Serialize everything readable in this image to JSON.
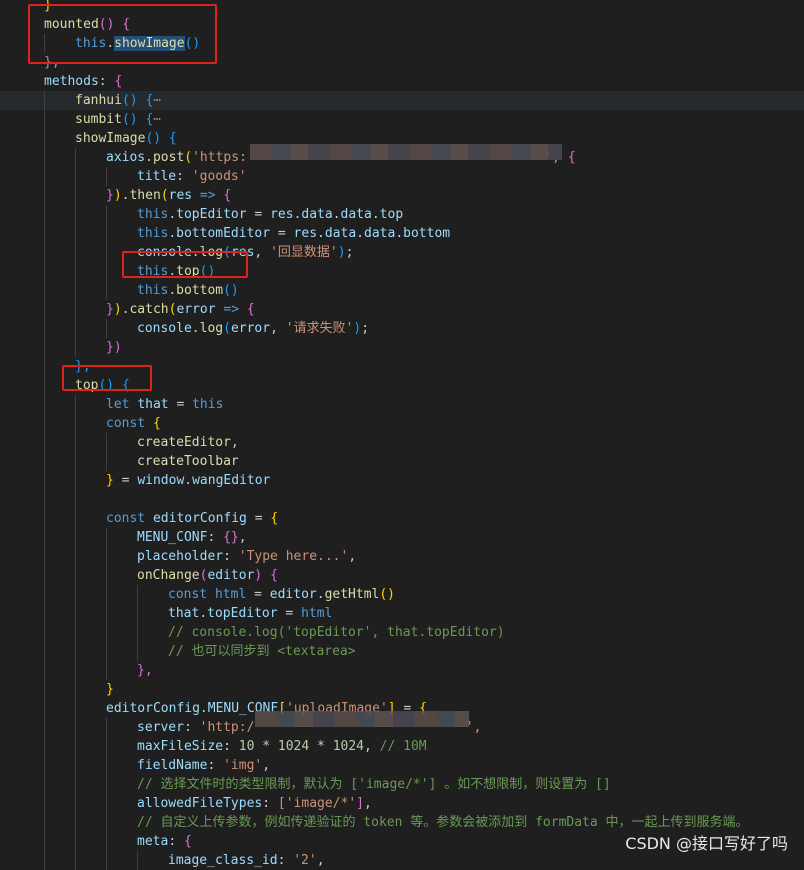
{
  "lines": [
    {
      "indent": 1,
      "tokens": [
        {
          "t": "}",
          "c": "b1"
        }
      ]
    },
    {
      "indent": 1,
      "tokens": [
        {
          "t": "mounted",
          "c": "fn"
        },
        {
          "t": "() {",
          "c": "b2"
        }
      ]
    },
    {
      "indent": 2,
      "tokens": [
        {
          "t": "this",
          "c": "kw"
        },
        {
          "t": ".",
          "c": "pn"
        },
        {
          "t": "showImage",
          "c": "fn sel"
        },
        {
          "t": "()",
          "c": "b3"
        }
      ]
    },
    {
      "indent": 1,
      "tokens": [
        {
          "t": "},",
          "c": "b2"
        }
      ]
    },
    {
      "indent": 1,
      "tokens": [
        {
          "t": "methods",
          "c": "prop"
        },
        {
          "t": ": ",
          "c": "pn"
        },
        {
          "t": "{",
          "c": "b2"
        }
      ]
    },
    {
      "indent": 2,
      "hl": true,
      "tokens": [
        {
          "t": "fanhui",
          "c": "fn"
        },
        {
          "t": "() {",
          "c": "b3"
        },
        {
          "t": "⋯",
          "c": "fold"
        }
      ]
    },
    {
      "indent": 2,
      "tokens": [
        {
          "t": "sumbit",
          "c": "fn"
        },
        {
          "t": "() {",
          "c": "b3"
        },
        {
          "t": "⋯",
          "c": "fold"
        }
      ]
    },
    {
      "indent": 2,
      "tokens": [
        {
          "t": "showImage",
          "c": "fn"
        },
        {
          "t": "() {",
          "c": "b3"
        }
      ]
    },
    {
      "indent": 3,
      "tokens": [
        {
          "t": "axios",
          "c": "prop"
        },
        {
          "t": ".",
          "c": "pn"
        },
        {
          "t": "post",
          "c": "fn"
        },
        {
          "t": "(",
          "c": "b1"
        },
        {
          "t": "'https:",
          "c": "str"
        },
        {
          "t": "                                      ",
          "c": "pn"
        },
        {
          "t": "', ",
          "c": "str"
        },
        {
          "t": "{",
          "c": "b2"
        }
      ]
    },
    {
      "indent": 4,
      "tokens": [
        {
          "t": "title",
          "c": "prop"
        },
        {
          "t": ": ",
          "c": "pn"
        },
        {
          "t": "'goods'",
          "c": "str"
        }
      ]
    },
    {
      "indent": 3,
      "tokens": [
        {
          "t": "}",
          "c": "b2"
        },
        {
          "t": ")",
          "c": "b1"
        },
        {
          "t": ".",
          "c": "pn"
        },
        {
          "t": "then",
          "c": "fn"
        },
        {
          "t": "(",
          "c": "b1"
        },
        {
          "t": "res",
          "c": "prop"
        },
        {
          "t": " => ",
          "c": "kw"
        },
        {
          "t": "{",
          "c": "b2"
        }
      ]
    },
    {
      "indent": 4,
      "tokens": [
        {
          "t": "this",
          "c": "kw"
        },
        {
          "t": ".",
          "c": "pn"
        },
        {
          "t": "topEditor",
          "c": "prop"
        },
        {
          "t": " = ",
          "c": "pn"
        },
        {
          "t": "res",
          "c": "prop"
        },
        {
          "t": ".",
          "c": "pn"
        },
        {
          "t": "data",
          "c": "prop"
        },
        {
          "t": ".",
          "c": "pn"
        },
        {
          "t": "data",
          "c": "prop"
        },
        {
          "t": ".",
          "c": "pn"
        },
        {
          "t": "top",
          "c": "prop"
        }
      ]
    },
    {
      "indent": 4,
      "tokens": [
        {
          "t": "this",
          "c": "kw"
        },
        {
          "t": ".",
          "c": "pn"
        },
        {
          "t": "bottomEditor",
          "c": "prop"
        },
        {
          "t": " = ",
          "c": "pn"
        },
        {
          "t": "res",
          "c": "prop"
        },
        {
          "t": ".",
          "c": "pn"
        },
        {
          "t": "data",
          "c": "prop"
        },
        {
          "t": ".",
          "c": "pn"
        },
        {
          "t": "data",
          "c": "prop"
        },
        {
          "t": ".",
          "c": "pn"
        },
        {
          "t": "bottom",
          "c": "prop"
        }
      ]
    },
    {
      "indent": 4,
      "tokens": [
        {
          "t": "console",
          "c": "prop"
        },
        {
          "t": ".",
          "c": "pn"
        },
        {
          "t": "log",
          "c": "fn"
        },
        {
          "t": "(",
          "c": "b3"
        },
        {
          "t": "res",
          "c": "prop"
        },
        {
          "t": ", ",
          "c": "pn"
        },
        {
          "t": "'回显数据'",
          "c": "str"
        },
        {
          "t": ")",
          "c": "b3"
        },
        {
          "t": ";",
          "c": "pn"
        }
      ]
    },
    {
      "indent": 4,
      "tokens": [
        {
          "t": "this",
          "c": "kw"
        },
        {
          "t": ".",
          "c": "pn"
        },
        {
          "t": "top",
          "c": "fn"
        },
        {
          "t": "()",
          "c": "b3"
        }
      ]
    },
    {
      "indent": 4,
      "tokens": [
        {
          "t": "this",
          "c": "kw"
        },
        {
          "t": ".",
          "c": "pn"
        },
        {
          "t": "bottom",
          "c": "fn"
        },
        {
          "t": "()",
          "c": "b3"
        }
      ]
    },
    {
      "indent": 3,
      "tokens": [
        {
          "t": "}",
          "c": "b2"
        },
        {
          "t": ")",
          "c": "b1"
        },
        {
          "t": ".",
          "c": "pn"
        },
        {
          "t": "catch",
          "c": "fn"
        },
        {
          "t": "(",
          "c": "b1"
        },
        {
          "t": "error",
          "c": "prop"
        },
        {
          "t": " => ",
          "c": "kw"
        },
        {
          "t": "{",
          "c": "b2"
        }
      ]
    },
    {
      "indent": 4,
      "tokens": [
        {
          "t": "console",
          "c": "prop"
        },
        {
          "t": ".",
          "c": "pn"
        },
        {
          "t": "log",
          "c": "fn"
        },
        {
          "t": "(",
          "c": "b3"
        },
        {
          "t": "error",
          "c": "prop"
        },
        {
          "t": ", ",
          "c": "pn"
        },
        {
          "t": "'请求失败'",
          "c": "str"
        },
        {
          "t": ")",
          "c": "b3"
        },
        {
          "t": ";",
          "c": "pn"
        }
      ]
    },
    {
      "indent": 3,
      "tokens": [
        {
          "t": "})",
          "c": "b2"
        }
      ]
    },
    {
      "indent": 2,
      "tokens": [
        {
          "t": "},",
          "c": "b3"
        }
      ]
    },
    {
      "indent": 2,
      "tokens": [
        {
          "t": "top",
          "c": "fn"
        },
        {
          "t": "() {",
          "c": "b3"
        }
      ]
    },
    {
      "indent": 3,
      "tokens": [
        {
          "t": "let",
          "c": "kw"
        },
        {
          "t": " ",
          "c": "pn"
        },
        {
          "t": "that",
          "c": "prop"
        },
        {
          "t": " = ",
          "c": "pn"
        },
        {
          "t": "this",
          "c": "kw"
        }
      ]
    },
    {
      "indent": 3,
      "tokens": [
        {
          "t": "const",
          "c": "kw"
        },
        {
          "t": " ",
          "c": "pn"
        },
        {
          "t": "{",
          "c": "b1"
        }
      ]
    },
    {
      "indent": 4,
      "tokens": [
        {
          "t": "createEditor",
          "c": "fn"
        },
        {
          "t": ",",
          "c": "pn"
        }
      ]
    },
    {
      "indent": 4,
      "tokens": [
        {
          "t": "createToolbar",
          "c": "fn"
        }
      ]
    },
    {
      "indent": 3,
      "tokens": [
        {
          "t": "}",
          "c": "b1"
        },
        {
          "t": " = ",
          "c": "pn"
        },
        {
          "t": "window",
          "c": "prop"
        },
        {
          "t": ".",
          "c": "pn"
        },
        {
          "t": "wangEditor",
          "c": "prop"
        }
      ]
    },
    {
      "indent": 3,
      "tokens": []
    },
    {
      "indent": 3,
      "tokens": [
        {
          "t": "const",
          "c": "kw"
        },
        {
          "t": " ",
          "c": "pn"
        },
        {
          "t": "editorConfig",
          "c": "prop"
        },
        {
          "t": " = ",
          "c": "pn"
        },
        {
          "t": "{",
          "c": "b1"
        }
      ]
    },
    {
      "indent": 4,
      "tokens": [
        {
          "t": "MENU_CONF",
          "c": "prop"
        },
        {
          "t": ": ",
          "c": "pn"
        },
        {
          "t": "{}",
          "c": "b2"
        },
        {
          "t": ",",
          "c": "pn"
        }
      ]
    },
    {
      "indent": 4,
      "tokens": [
        {
          "t": "placeholder",
          "c": "prop"
        },
        {
          "t": ": ",
          "c": "pn"
        },
        {
          "t": "'Type here...'",
          "c": "str"
        },
        {
          "t": ",",
          "c": "pn"
        }
      ]
    },
    {
      "indent": 4,
      "tokens": [
        {
          "t": "onChange",
          "c": "fn"
        },
        {
          "t": "(",
          "c": "b2"
        },
        {
          "t": "editor",
          "c": "prop"
        },
        {
          "t": ") {",
          "c": "b2"
        }
      ]
    },
    {
      "indent": 5,
      "tokens": [
        {
          "t": "const",
          "c": "kw"
        },
        {
          "t": " ",
          "c": "pn"
        },
        {
          "t": "html",
          "c": "kw"
        },
        {
          "t": " = ",
          "c": "pn"
        },
        {
          "t": "editor",
          "c": "prop"
        },
        {
          "t": ".",
          "c": "pn"
        },
        {
          "t": "getHtml",
          "c": "fn"
        },
        {
          "t": "()",
          "c": "b1"
        }
      ]
    },
    {
      "indent": 5,
      "tokens": [
        {
          "t": "that",
          "c": "prop"
        },
        {
          "t": ".",
          "c": "pn"
        },
        {
          "t": "topEditor",
          "c": "prop"
        },
        {
          "t": " = ",
          "c": "pn"
        },
        {
          "t": "html",
          "c": "kw"
        }
      ]
    },
    {
      "indent": 5,
      "tokens": [
        {
          "t": "// console.log('topEditor', that.topEditor)",
          "c": "cmt"
        }
      ]
    },
    {
      "indent": 5,
      "tokens": [
        {
          "t": "// 也可以同步到 <textarea>",
          "c": "cmt"
        }
      ]
    },
    {
      "indent": 4,
      "tokens": [
        {
          "t": "},",
          "c": "b2"
        }
      ]
    },
    {
      "indent": 3,
      "tokens": [
        {
          "t": "}",
          "c": "b1"
        }
      ]
    },
    {
      "indent": 3,
      "tokens": [
        {
          "t": "editorConfig",
          "c": "prop"
        },
        {
          "t": ".",
          "c": "pn"
        },
        {
          "t": "MENU_CONF",
          "c": "prop"
        },
        {
          "t": "[",
          "c": "b1"
        },
        {
          "t": "'uploadImage'",
          "c": "str"
        },
        {
          "t": "]",
          "c": "b1"
        },
        {
          "t": " = ",
          "c": "pn"
        },
        {
          "t": "{",
          "c": "b1"
        }
      ]
    },
    {
      "indent": 4,
      "tokens": [
        {
          "t": "server",
          "c": "prop"
        },
        {
          "t": ": ",
          "c": "pn"
        },
        {
          "t": "'http:/",
          "c": "str"
        },
        {
          "t": "                           ",
          "c": "pn"
        },
        {
          "t": "',",
          "c": "str"
        }
      ]
    },
    {
      "indent": 4,
      "tokens": [
        {
          "t": "maxFileSize",
          "c": "prop"
        },
        {
          "t": ": ",
          "c": "pn"
        },
        {
          "t": "10",
          "c": "num"
        },
        {
          "t": " * ",
          "c": "pn"
        },
        {
          "t": "1024",
          "c": "num"
        },
        {
          "t": " * ",
          "c": "pn"
        },
        {
          "t": "1024",
          "c": "num"
        },
        {
          "t": ", ",
          "c": "pn"
        },
        {
          "t": "// 10M",
          "c": "cmt"
        }
      ]
    },
    {
      "indent": 4,
      "tokens": [
        {
          "t": "fieldName",
          "c": "prop"
        },
        {
          "t": ": ",
          "c": "pn"
        },
        {
          "t": "'img'",
          "c": "str"
        },
        {
          "t": ",",
          "c": "pn"
        }
      ]
    },
    {
      "indent": 4,
      "tokens": [
        {
          "t": "// 选择文件时的类型限制，默认为 ['image/*'] 。如不想限制，则设置为 []",
          "c": "cmt"
        }
      ]
    },
    {
      "indent": 4,
      "tokens": [
        {
          "t": "allowedFileTypes",
          "c": "prop"
        },
        {
          "t": ": ",
          "c": "pn"
        },
        {
          "t": "[",
          "c": "b2"
        },
        {
          "t": "'image/*'",
          "c": "str"
        },
        {
          "t": "]",
          "c": "b2"
        },
        {
          "t": ",",
          "c": "pn"
        }
      ]
    },
    {
      "indent": 4,
      "tokens": [
        {
          "t": "// 自定义上传参数，例如传递验证的 token 等。参数会被添加到 formData 中，一起上传到服务端。",
          "c": "cmt"
        }
      ]
    },
    {
      "indent": 4,
      "tokens": [
        {
          "t": "meta",
          "c": "prop"
        },
        {
          "t": ": ",
          "c": "pn"
        },
        {
          "t": "{",
          "c": "b2"
        }
      ]
    },
    {
      "indent": 5,
      "tokens": [
        {
          "t": "image_class_id",
          "c": "prop"
        },
        {
          "t": ": ",
          "c": "pn"
        },
        {
          "t": "'2'",
          "c": "str"
        },
        {
          "t": ",",
          "c": "pn"
        }
      ]
    }
  ],
  "watermark": "CSDN @接口写好了吗",
  "colors": {
    "background": "#1f1f1f",
    "annotation": "#e0221c"
  }
}
